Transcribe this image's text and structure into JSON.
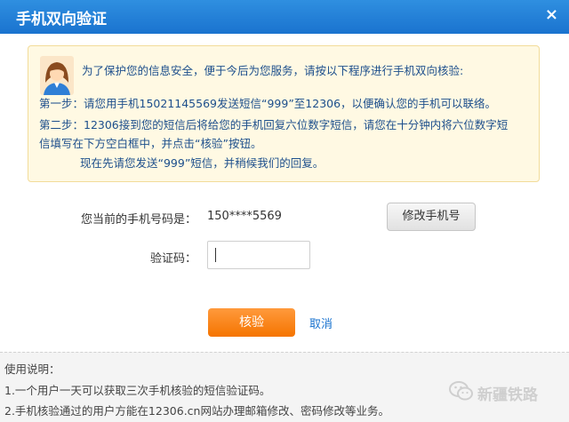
{
  "dialog": {
    "title": "手机双向验证",
    "close_glyph": "×"
  },
  "notice": {
    "avatar_icon": "user-avatar-icon",
    "line1": "为了保护您的信息安全，便于今后为您服务，请按以下程序进行手机双向核验:",
    "step1": "第一步：请您用手机15021145569发送短信“999”至12306，以便确认您的手机可以联络。",
    "step2a": "第二步：12306接到您的短信后将给您的手机回复六位数字短信，请您在十分钟内将六位数字短",
    "step2b": "信填写在下方空白框中，并点击“核验”按钮。",
    "line_last": "现在先请您发送“999”短信，并稍候我们的回复。"
  },
  "form": {
    "phone_label": "您当前的手机号码是：",
    "phone_value": "150****5569",
    "change_phone_button": "修改手机号",
    "code_label": "验证码：",
    "code_value": "",
    "verify_button": "核验",
    "cancel_link": "取消"
  },
  "help": {
    "title": "使用说明：",
    "item1": "1.一个用户一天可以获取三次手机核验的短信验证码。",
    "item2": "2.手机核验通过的用户方能在12306.cn网站办理邮箱修改、密码修改等业务。"
  },
  "watermark": {
    "text": "新疆铁路",
    "icon": "wechat-icon"
  },
  "colors": {
    "titlebar": "#1a73cf",
    "notice_bg": "#fff9e3",
    "notice_text": "#1d4f8c",
    "verify_button": "#f57400",
    "link": "#1a73cf"
  }
}
